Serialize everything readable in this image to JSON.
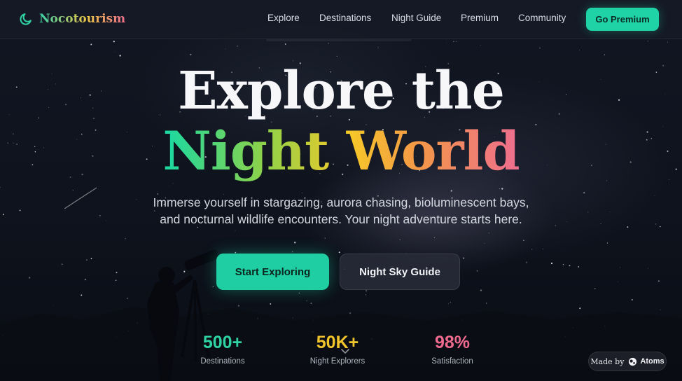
{
  "brand": {
    "name": "Nocotourism",
    "icon": "moon-icon"
  },
  "nav": {
    "links": [
      "Explore",
      "Destinations",
      "Night Guide",
      "Premium",
      "Community"
    ],
    "cta_label": "Go Premium"
  },
  "hero": {
    "headline_line1": "Explore the",
    "headline_line2": "Night World",
    "subtitle_line1": "Immerse yourself in stargazing, aurora chasing, bioluminescent bays,",
    "subtitle_line2": "and nocturnal wildlife encounters. Your night adventure starts here.",
    "primary_button": "Start Exploring",
    "secondary_button": "Night Sky Guide"
  },
  "stats": [
    {
      "value": "500+",
      "label": "Destinations",
      "color": "#2fd3a3"
    },
    {
      "value": "50K+",
      "label": "Night Explorers",
      "color": "#f2c42b"
    },
    {
      "value": "98%",
      "label": "Satisfaction",
      "color": "#ee6a8e"
    }
  ],
  "badge": {
    "prefix": "Made by",
    "brand": "Atoms"
  },
  "colors": {
    "accent": "#1fcfa3",
    "gradient": [
      "#17d9a4",
      "#8cd24a",
      "#f6c928",
      "#f39748",
      "#ee6d8f"
    ],
    "background": "#0e131d"
  }
}
